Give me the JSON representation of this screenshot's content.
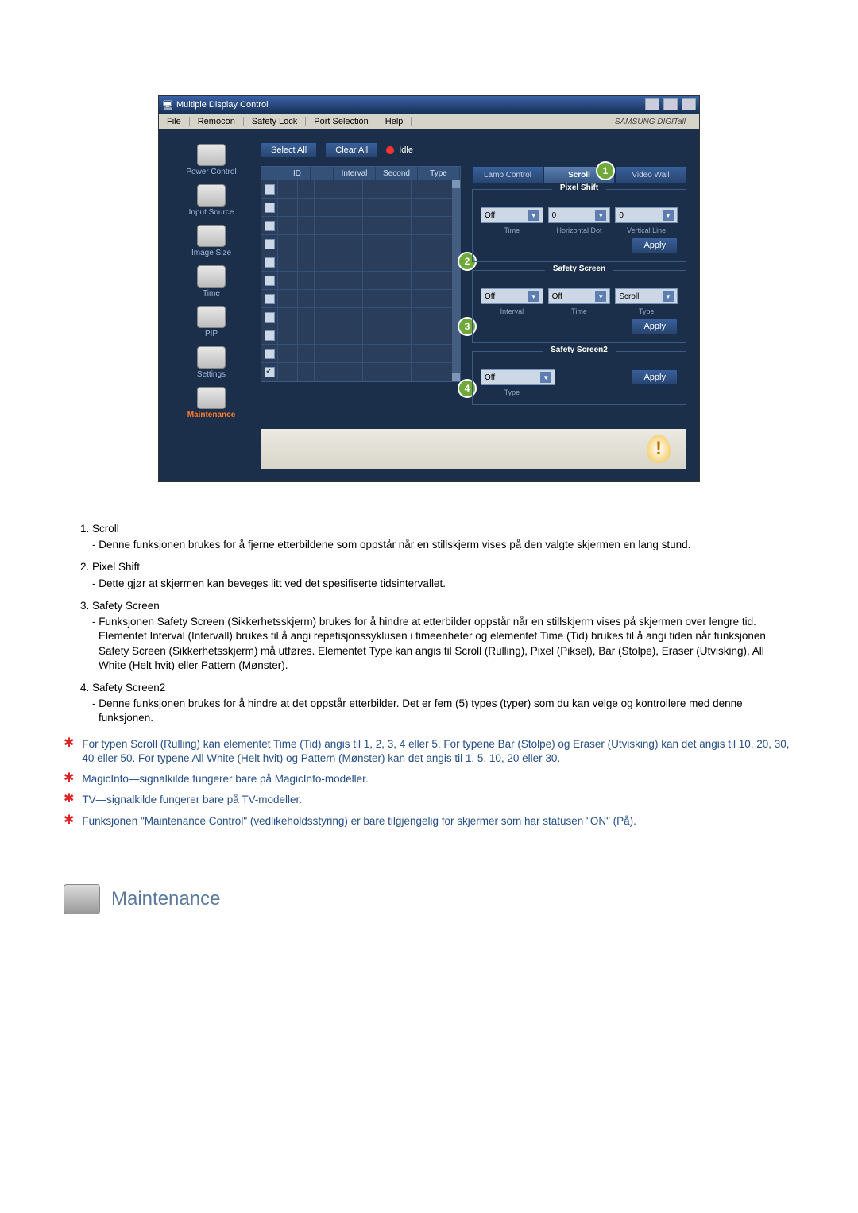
{
  "window": {
    "title": "Multiple Display Control"
  },
  "menubar": {
    "file": "File",
    "remocon": "Remocon",
    "safety_lock": "Safety Lock",
    "port_selection": "Port Selection",
    "help": "Help",
    "brand": "SAMSUNG DIGITall"
  },
  "sidebar": {
    "items": [
      {
        "label": "Power Control"
      },
      {
        "label": "Input Source"
      },
      {
        "label": "Image Size"
      },
      {
        "label": "Time"
      },
      {
        "label": "PIP"
      },
      {
        "label": "Settings"
      },
      {
        "label": "Maintenance"
      }
    ]
  },
  "toolbar": {
    "select_all": "Select All",
    "clear_all": "Clear All",
    "idle": "Idle"
  },
  "table": {
    "headers": {
      "id": "ID",
      "interval": "Interval",
      "second": "Second",
      "type": "Type"
    },
    "row_count": 11,
    "first_checked": true
  },
  "tabs": {
    "lamp": "Lamp Control",
    "scroll": "Scroll",
    "videowall": "Video Wall",
    "active": "Scroll"
  },
  "pixel_shift": {
    "title": "Pixel Shift",
    "time_value": "Off",
    "hdot_value": "0",
    "vline_value": "0",
    "time_label": "Time",
    "hdot_label": "Horizontal Dot",
    "vline_label": "Vertical Line",
    "apply": "Apply"
  },
  "safety_screen": {
    "title": "Safety Screen",
    "interval_value": "Off",
    "time_value": "Off",
    "type_value": "Scroll",
    "interval_label": "Interval",
    "time_label": "Time",
    "type_label": "Type",
    "apply": "Apply"
  },
  "safety_screen2": {
    "title": "Safety Screen2",
    "type_value": "Off",
    "type_label": "Type",
    "apply": "Apply"
  },
  "callouts": {
    "c1": "1",
    "c2": "2",
    "c3": "3",
    "c4": "4"
  },
  "excl": "!",
  "doc": {
    "items": [
      {
        "title": "Scroll",
        "body": "- Denne funksjonen brukes for å fjerne etterbildene som oppstår når en stillskjerm vises på den valgte skjermen en lang stund."
      },
      {
        "title": "Pixel Shift",
        "body": "- Dette gjør at skjermen kan beveges litt ved det spesifiserte tidsintervallet."
      },
      {
        "title": "Safety Screen",
        "body": "- Funksjonen Safety Screen (Sikkerhetsskjerm) brukes for å hindre at etterbilder oppstår når en stillskjerm vises på skjermen over lengre tid.  Elementet Interval (Intervall) brukes til å angi repetisjonssyklusen i timeenheter og elementet Time (Tid) brukes til å angi tiden når funksjonen Safety Screen (Sikkerhetsskjerm) må utføres. Elementet Type kan angis til Scroll (Rulling), Pixel (Piksel), Bar (Stolpe), Eraser (Utvisking), All White (Helt hvit) eller Pattern (Mønster)."
      },
      {
        "title": "Safety Screen2",
        "body": "- Denne funksjonen brukes for å hindre at det oppstår etterbilder. Det er fem (5) types (typer) som du kan velge og kontrollere med denne funksjonen."
      }
    ],
    "notes": [
      "For typen Scroll (Rulling) kan elementet Time (Tid) angis til 1, 2, 3, 4 eller 5. For typene Bar (Stolpe) og Eraser (Utvisking) kan det angis til 10, 20, 30, 40 eller 50. For typene All White (Helt hvit) og Pattern (Mønster) kan det angis til 1, 5, 10, 20 eller 30.",
      "MagicInfo—signalkilde fungerer bare på MagicInfo-modeller.",
      "TV—signalkilde fungerer bare på TV-modeller.",
      "Funksjonen \"Maintenance Control\" (vedlikeholdsstyring) er bare tilgjengelig for skjermer som har statusen \"ON\" (På)."
    ]
  },
  "heading": "Maintenance"
}
